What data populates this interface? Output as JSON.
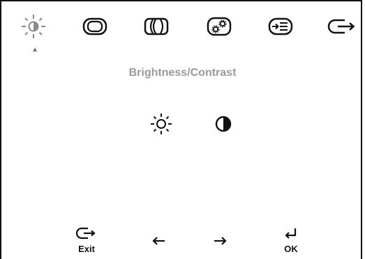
{
  "header": {
    "tabs": [
      {
        "id": "brightness",
        "icon": "brightness-icon",
        "selected": true
      },
      {
        "id": "image-properties",
        "icon": "screen-icon"
      },
      {
        "id": "image-position",
        "icon": "position-icon"
      },
      {
        "id": "options",
        "icon": "settings-icon"
      },
      {
        "id": "input-signal",
        "icon": "input-icon"
      },
      {
        "id": "exit",
        "icon": "exit-icon"
      }
    ]
  },
  "main": {
    "title": "Brightness/Contrast",
    "options": [
      {
        "id": "brightness",
        "icon": "sun-icon"
      },
      {
        "id": "contrast",
        "icon": "contrast-icon"
      }
    ]
  },
  "footer": {
    "exit_label": "Exit",
    "left_icon": "arrow-left-icon",
    "right_icon": "arrow-right-icon",
    "ok_label": "OK"
  },
  "colors": {
    "selected_tab": "#8a8a8a",
    "title": "#9a9a9a",
    "icon": "#111111"
  }
}
